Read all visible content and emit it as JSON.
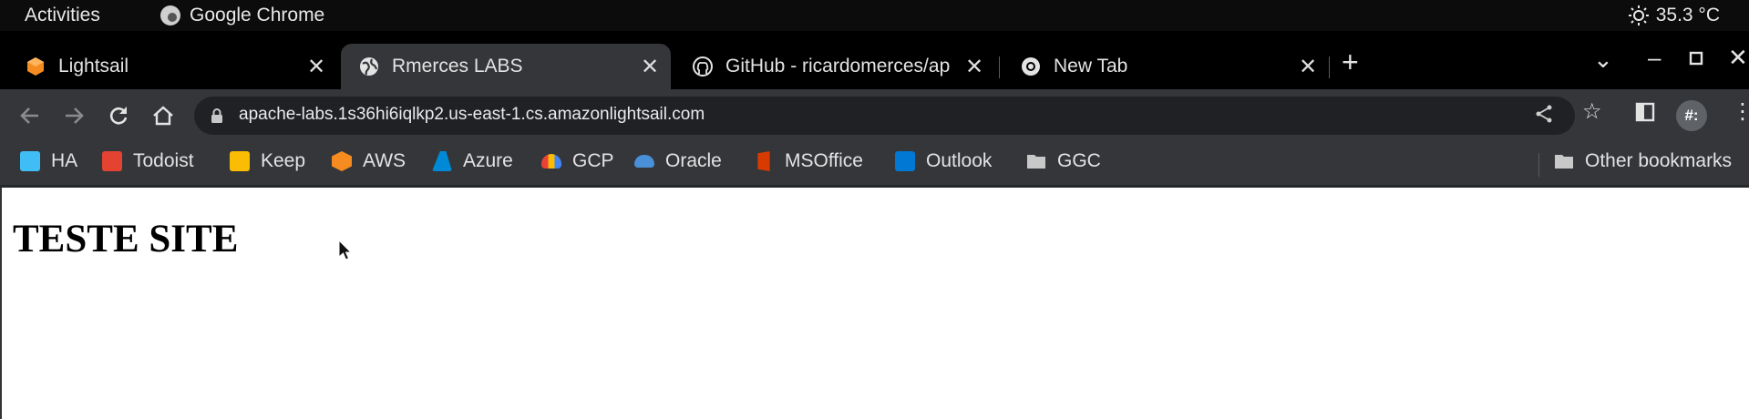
{
  "system_bar": {
    "activities": "Activities",
    "app_name": "Google Chrome",
    "temperature": "35.3 °C"
  },
  "tabs": [
    {
      "label": "Lightsail",
      "icon": "lightsail-icon",
      "active": false
    },
    {
      "label": "Rmerces LABS",
      "icon": "globe-icon",
      "active": true
    },
    {
      "label": "GitHub - ricardomerces/ap",
      "icon": "github-icon",
      "active": false
    },
    {
      "label": "New Tab",
      "icon": "chrome-icon",
      "active": false
    }
  ],
  "new_tab_symbol": "+",
  "window_controls": {
    "tab_search": "⌄",
    "minimize": "–",
    "maximize": "▫",
    "close": "✕"
  },
  "toolbar": {
    "url": "apache-labs.1s36hi6iqlkp2.us-east-1.cs.amazonlightsail.com",
    "extension_badge": "#:"
  },
  "bookmarks": [
    {
      "label": "HA",
      "color": "#41bdf5"
    },
    {
      "label": "Todoist",
      "color": "#e44332"
    },
    {
      "label": "Keep",
      "color": "#fbbc04"
    },
    {
      "label": "AWS",
      "color": "#f68b1f"
    },
    {
      "label": "Azure",
      "color": "#0089d6"
    },
    {
      "label": "GCP",
      "color": "#ea4335"
    },
    {
      "label": "Oracle",
      "color": "#4a90d9"
    },
    {
      "label": "MSOffice",
      "color": "#d83b01"
    },
    {
      "label": "Outlook",
      "color": "#0078d4"
    },
    {
      "label": "GGC",
      "color": "#c8c8c8"
    }
  ],
  "other_bookmarks": "Other bookmarks",
  "page": {
    "heading": "TESTE SITE"
  }
}
